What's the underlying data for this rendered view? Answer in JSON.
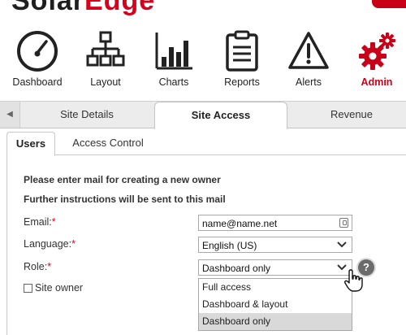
{
  "brand": {
    "solar": "Solar",
    "edge": "Edge"
  },
  "nav": [
    {
      "key": "dashboard",
      "label": "Dashboard",
      "icon": "speedometer-icon"
    },
    {
      "key": "layout",
      "label": "Layout",
      "icon": "sitemap-icon"
    },
    {
      "key": "charts",
      "label": "Charts",
      "icon": "bar-chart-icon"
    },
    {
      "key": "reports",
      "label": "Reports",
      "icon": "clipboard-icon"
    },
    {
      "key": "alerts",
      "label": "Alerts",
      "icon": "warning-icon"
    },
    {
      "key": "admin",
      "label": "Admin",
      "icon": "gears-icon"
    }
  ],
  "main_tabs": [
    {
      "label": "Site Details",
      "active": false
    },
    {
      "label": "Site Access",
      "active": true
    },
    {
      "label": "Revenue",
      "active": false
    }
  ],
  "sub_tabs": [
    {
      "label": "Users",
      "active": true
    },
    {
      "label": "Access Control",
      "active": false
    }
  ],
  "form": {
    "instruction_1": "Please enter mail for creating a new owner",
    "instruction_2": "Further instructions will be sent to this mail",
    "email_label": "Email:",
    "email_value": "name@name.net",
    "language_label": "Language:",
    "language_value": "English (US)",
    "role_label": "Role:",
    "role_value": "Dashboard only",
    "required_mark": "*",
    "help_symbol": "?",
    "site_owner_label": "Site owner",
    "site_owner_checked": false,
    "role_options": [
      "Full access",
      "Dashboard & layout",
      "Dashboard only"
    ],
    "role_selected_index": 2
  },
  "colors": {
    "accent": "#c80018",
    "tab_bg": "#ececec",
    "selected_option": "#d9d9d9"
  }
}
